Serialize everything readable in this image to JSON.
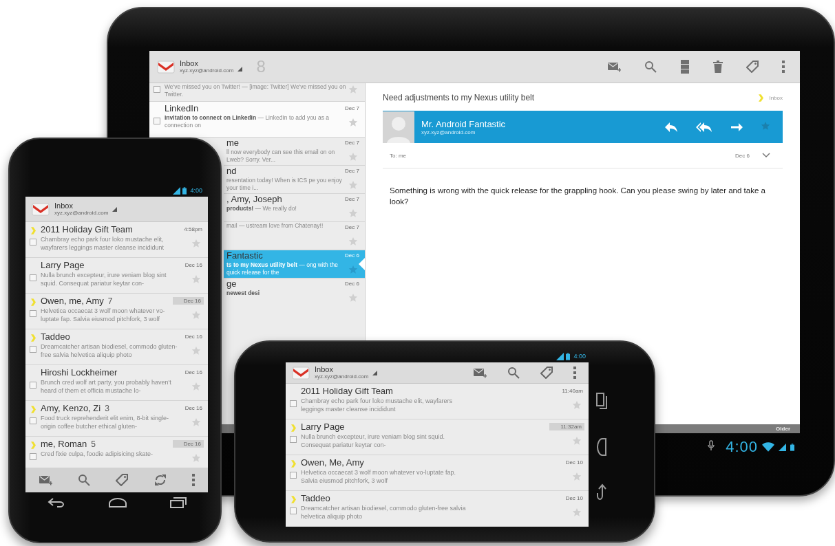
{
  "tablet": {
    "account": {
      "title": "Inbox",
      "email": "xyz.xyz@android.com",
      "unread_count": "8"
    },
    "list": [
      {
        "snippet": "We've missed you on Twitter! — [image: Twitter] We've missed you on Twitter.",
        "unread": false,
        "selected": false,
        "checked": false
      },
      {
        "sender": "LinkedIn",
        "snippet": "**Invitation to connect on LinkedIn** — LinkedIn to add you as a connection on",
        "date": "Dec 7",
        "unread": true,
        "selected": false,
        "checked": false
      },
      {
        "sender": "me",
        "snippet": "ll now everybody can see this email on on Lweb? Sorry. Ver...",
        "date": "Dec 7",
        "unread": false,
        "selected": false
      },
      {
        "sender": "nd",
        "snippet": "resentation today! When is ICS pe you enjoy your time i...",
        "date": "Dec 7",
        "unread": false,
        "selected": false
      },
      {
        "sender": ", Amy, Joseph",
        "snippet": "**products!** — We really do!",
        "date": "Dec 7",
        "unread": false,
        "selected": false
      },
      {
        "snippet": "mail — ustream love from Chatenay!!",
        "date": "Dec 7",
        "unread": false,
        "selected": false
      },
      {
        "sender": "Fantastic",
        "snippet": "**ts to my Nexus utility belt** — ong with the quick release for the",
        "date": "Dec 6",
        "unread": false,
        "selected": true
      },
      {
        "sender": "ge",
        "snippet": "**newest desi**",
        "date": "Dec 6",
        "unread": false,
        "selected": false
      }
    ],
    "message": {
      "subject": "Need adjustments to my Nexus utility belt",
      "label": "Inbox",
      "sender": "Mr. Android Fantastic",
      "email": "xyz.xyz@android.com",
      "recipients": "To: me",
      "date": "Dec 6",
      "body": "Something is wrong with the quick release for the grappling hook. Can you please swing by later and take a look?"
    },
    "footer": "Older",
    "clock": "4:00"
  },
  "phone": {
    "clock": "4:00",
    "account": {
      "title": "Inbox",
      "email": "xyz.xyz@android.com"
    },
    "list": [
      {
        "sender": "2011 Holiday Gift Team",
        "snippet": "Chambray echo park four loko mustache elit, wayfarers leggings master cleanse incididunt",
        "date": "4:58pm",
        "important": true,
        "labeled": false,
        "checked": false
      },
      {
        "sender": "Larry Page",
        "snippet": "Nulla brunch excepteur, irure veniam blog sint squid. Consequat pariatur keytar con-",
        "date": "Dec 16",
        "important": false,
        "labeled": false,
        "checked": false
      },
      {
        "sender": "Owen, me, Amy",
        "count": "7",
        "snippet": "Helvetica occaecat 3 wolf moon whatever vo-luptate fap. Salvia eiusmod pitchfork, 3 wolf",
        "date": "Dec 16",
        "important": true,
        "labeled": true,
        "checked": false
      },
      {
        "sender": "Taddeo",
        "snippet": "Dreamcatcher artisan biodiesel, commodo gluten-free salvia helvetica aliquip photo",
        "date": "Dec 16",
        "important": true,
        "labeled": false,
        "checked": false
      },
      {
        "sender": "Hiroshi Lockheimer",
        "snippet": "Brunch cred wolf art party, you probably haven't heard of them et officia mustache lo-",
        "date": "Dec 16",
        "important": false,
        "labeled": false,
        "checked": false
      },
      {
        "sender": "Amy, Kenzo, Zi",
        "count": "3",
        "snippet": "Food truck reprehenderit elit enim, 8-bit single-origin coffee butcher ethical gluten-",
        "date": "Dec 16",
        "important": true,
        "labeled": false,
        "checked": false
      },
      {
        "sender": "me, Roman",
        "count": "5",
        "snippet": "Cred fixie culpa, foodie adipisicing skate-",
        "date": "Dec 16",
        "important": true,
        "labeled": true,
        "checked": false
      }
    ]
  },
  "landscape_phone": {
    "clock": "4:00",
    "account": {
      "title": "Inbox",
      "email": "xyz.xyz@android.com"
    },
    "list": [
      {
        "sender": "2011 Holiday Gift Team",
        "snippet": "Chambray echo park four loko mustache elit, wayfarers leggings master cleanse incididunt",
        "date": "11:40am",
        "important": false,
        "labeled": false,
        "checked": false
      },
      {
        "sender": "Larry Page",
        "snippet": "Nulla brunch excepteur, irure veniam blog sint squid. Consequat pariatur keytar con-",
        "date": "11:32am",
        "important": true,
        "labeled": true,
        "checked": false
      },
      {
        "sender": "Owen, Me, Amy",
        "snippet": "Helvetica occaecat 3 wolf moon whatever vo-luptate fap. Salvia eiusmod pitchfork, 3 wolf",
        "date": "Dec 10",
        "important": true,
        "labeled": false,
        "checked": false
      },
      {
        "sender": "Taddeo",
        "snippet": "Dreamcatcher artisan biodiesel, commodo gluten-free salvia helvetica aliquip photo",
        "date": "Dec 10",
        "important": true,
        "labeled": false,
        "checked": false
      }
    ]
  }
}
